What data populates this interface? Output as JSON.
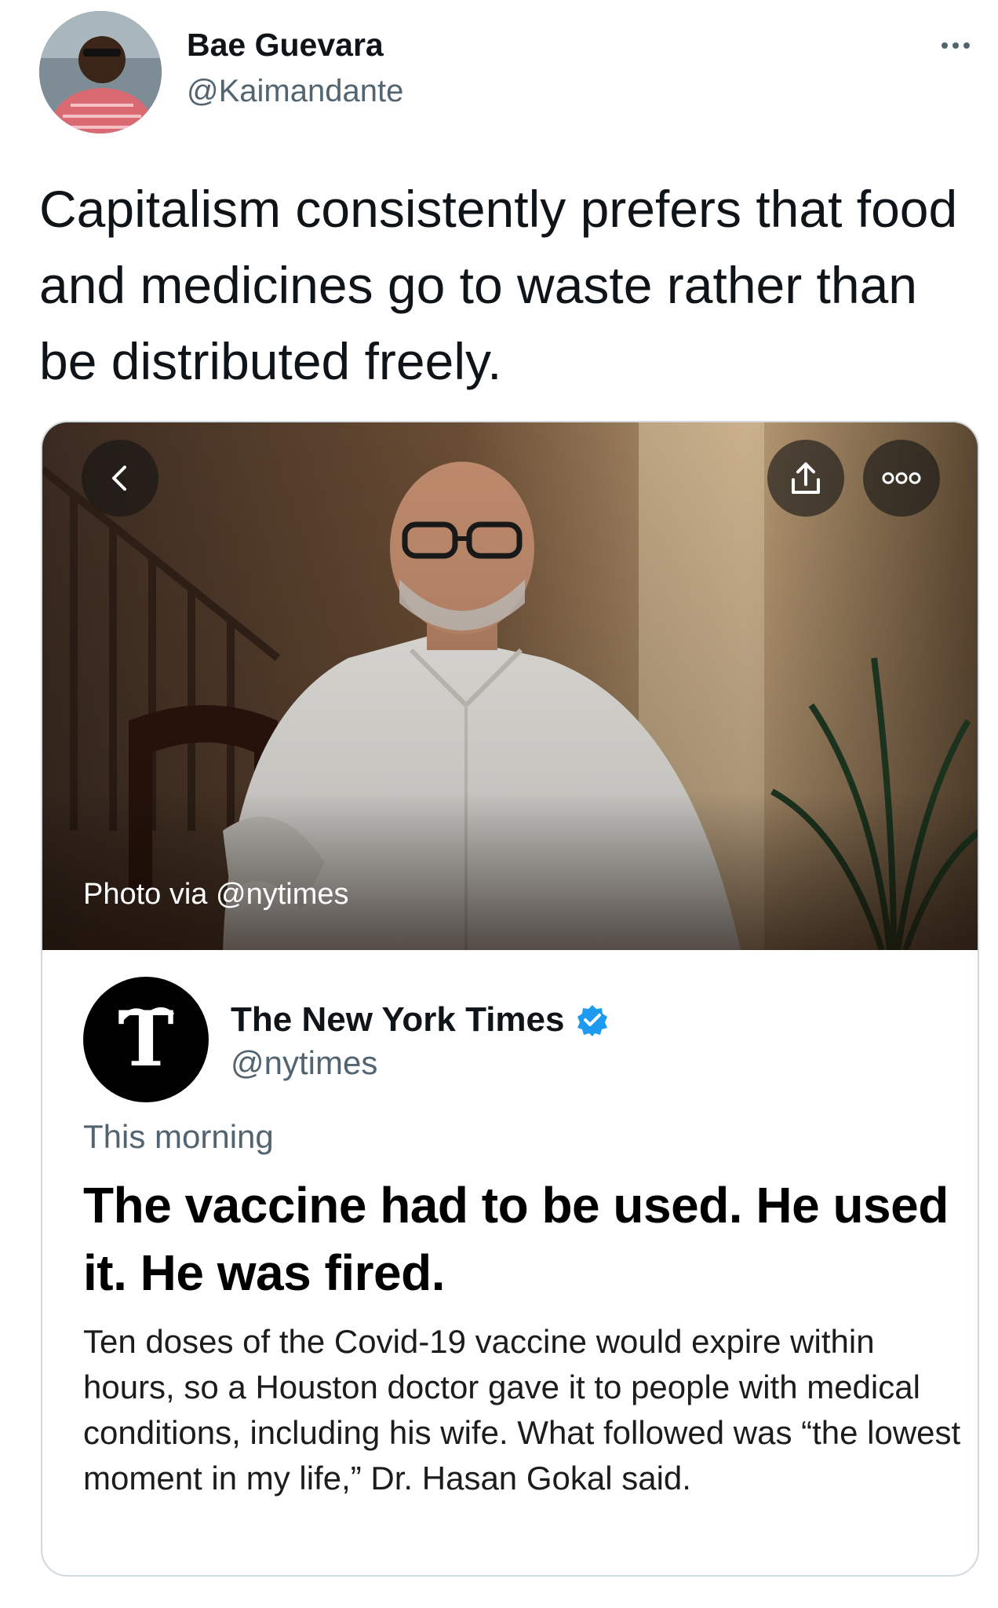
{
  "tweet": {
    "author": {
      "name": "Bae Guevara",
      "handle": "@Kaimandante"
    },
    "text": "Capitalism consistently prefers that food and medicines go to waste rather than be distributed freely."
  },
  "embedded_card": {
    "photo_credit": "Photo via @nytimes",
    "source": {
      "name": "The New York Times",
      "handle": "@nytimes",
      "verified": true
    },
    "timestamp": "This morning",
    "headline": "The vaccine had to be used. He used it. He was fired.",
    "summary": "Ten doses of the Covid-19 vaccine would expire within hours, so a Houston doctor gave it to people with medical conditions, including his wife. What followed was “the lowest moment in my life,” Dr. Hasan Gokal said."
  },
  "icons": {
    "more": "more-horizontal-icon",
    "back": "chevron-left-icon",
    "share": "share-icon",
    "card_more": "more-circle-icon",
    "verified": "verified-badge-icon"
  },
  "colors": {
    "text_primary": "#0f1419",
    "text_secondary": "#536471",
    "verified": "#1d9bf0",
    "card_border": "#cfd9de"
  }
}
